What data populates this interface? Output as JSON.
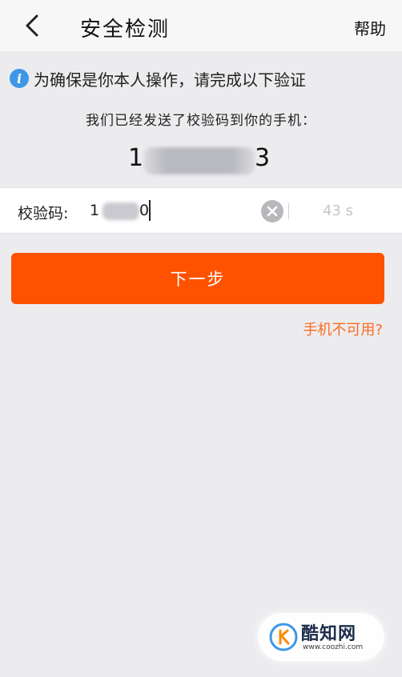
{
  "header": {
    "title": "安全检测",
    "help_label": "帮助",
    "back_icon": "chevron-left-icon"
  },
  "notice": {
    "icon": "info-icon",
    "icon_glyph": "i",
    "text": "为确保是你本人操作，请完成以下验证"
  },
  "sent_message": "我们已经发送了校验码到你的手机：",
  "phone": {
    "visible_start": "1",
    "visible_end": "3"
  },
  "code_field": {
    "label": "校验码:",
    "value_start": "1",
    "value_end": "0",
    "countdown": "43 s"
  },
  "next_button": "下一步",
  "phone_unavailable_link": "手机不可用?",
  "watermark": {
    "name": "酷知网",
    "url": "www.coozhi.com"
  },
  "colors": {
    "accent": "#ff5200",
    "link": "#ff6a1f",
    "info": "#3d97e6",
    "background": "#ececef"
  }
}
